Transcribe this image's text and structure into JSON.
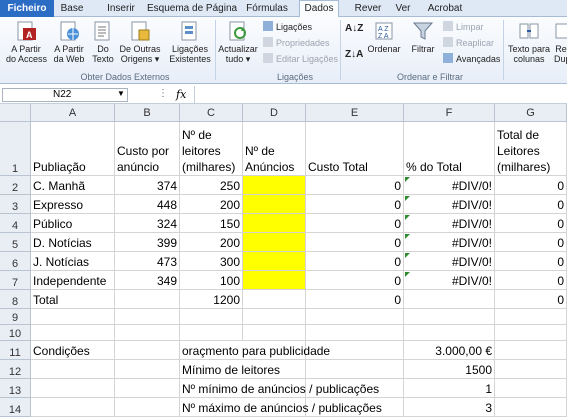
{
  "tabs": [
    "Ficheiro",
    "Base",
    "Inserir",
    "Esquema de Página",
    "Fórmulas",
    "Dados",
    "Rever",
    "Ver",
    "Acrobat"
  ],
  "ribbon": {
    "external": {
      "access": "A Partir\ndo Access",
      "web": "A Partir\nda Web",
      "text": "Do\nTexto",
      "other": "De Outras\nOrigens ▾",
      "existing": "Ligações\nExistentes",
      "group": "Obter Dados Externos"
    },
    "connections": {
      "refresh": "Actualizar\ntudo ▾",
      "links": "Ligações",
      "properties": "Propriedades",
      "edit": "Editar Ligações",
      "group": "Ligações"
    },
    "sort": {
      "sort": "Ordenar",
      "filter": "Filtrar",
      "clear": "Limpar",
      "reapply": "Reaplicar",
      "advanced": "Avançadas",
      "group": "Ordenar e Filtrar"
    },
    "tools": {
      "text_columns": "Texto para\ncolunas",
      "dup": "Re\nDup"
    }
  },
  "formula_bar": {
    "name_box": "N22",
    "fx": "fx",
    "formula": ""
  },
  "columns": [
    "A",
    "B",
    "C",
    "D",
    "E",
    "F",
    "G"
  ],
  "rows": [
    {
      "n": "1",
      "A": "Publiação",
      "B": "Custo por\nanúncio",
      "C": "Nº de\nleitores\n(milhares)",
      "D": "Nº de\nAnúncios",
      "E": "Custo Total",
      "F": "% do Total",
      "G": "Total de\nLeitores\n(milhares)"
    },
    {
      "n": "2",
      "A": "C. Manhã",
      "B": "374",
      "C": "250",
      "D": "",
      "E": "0",
      "F": "#DIV/0!",
      "G": "0"
    },
    {
      "n": "3",
      "A": "Expresso",
      "B": "448",
      "C": "200",
      "D": "",
      "E": "0",
      "F": "#DIV/0!",
      "G": "0"
    },
    {
      "n": "4",
      "A": "Público",
      "B": "324",
      "C": "150",
      "D": "",
      "E": "0",
      "F": "#DIV/0!",
      "G": "0"
    },
    {
      "n": "5",
      "A": "D. Notícias",
      "B": "399",
      "C": "200",
      "D": "",
      "E": "0",
      "F": "#DIV/0!",
      "G": "0"
    },
    {
      "n": "6",
      "A": "J. Notícias",
      "B": "473",
      "C": "300",
      "D": "",
      "E": "0",
      "F": "#DIV/0!",
      "G": "0"
    },
    {
      "n": "7",
      "A": "Independente",
      "B": "349",
      "C": "100",
      "D": "",
      "E": "0",
      "F": "#DIV/0!",
      "G": "0"
    },
    {
      "n": "8",
      "A": "Total",
      "B": "",
      "C": "1200",
      "D": "",
      "E": "0",
      "F": "",
      "G": "0"
    },
    {
      "n": "9",
      "A": "",
      "B": "",
      "C": "",
      "D": "",
      "E": "",
      "F": "",
      "G": ""
    },
    {
      "n": "10",
      "A": "",
      "B": "",
      "C": "",
      "D": "",
      "E": "",
      "F": "",
      "G": ""
    },
    {
      "n": "11",
      "A": "Condições",
      "B": "",
      "C": "oraçmento para publicidade",
      "D": "",
      "E": "",
      "F": "3.000,00 €",
      "G": ""
    },
    {
      "n": "12",
      "A": "",
      "B": "",
      "C": "Mínimo de leitores",
      "D": "",
      "E": "",
      "F": "1500",
      "G": ""
    },
    {
      "n": "13",
      "A": "",
      "B": "",
      "C": "Nº mínimo de anúncios / publicações",
      "D": "",
      "E": "",
      "F": "1",
      "G": ""
    },
    {
      "n": "14",
      "A": "",
      "B": "",
      "C": "Nº máximo de anúncios / publicações",
      "D": "",
      "E": "",
      "F": "3",
      "G": ""
    }
  ],
  "colors": {
    "highlight": "#ffff00",
    "file_tab": "#2b6cc4",
    "error_marker": "#2e8b2e"
  }
}
